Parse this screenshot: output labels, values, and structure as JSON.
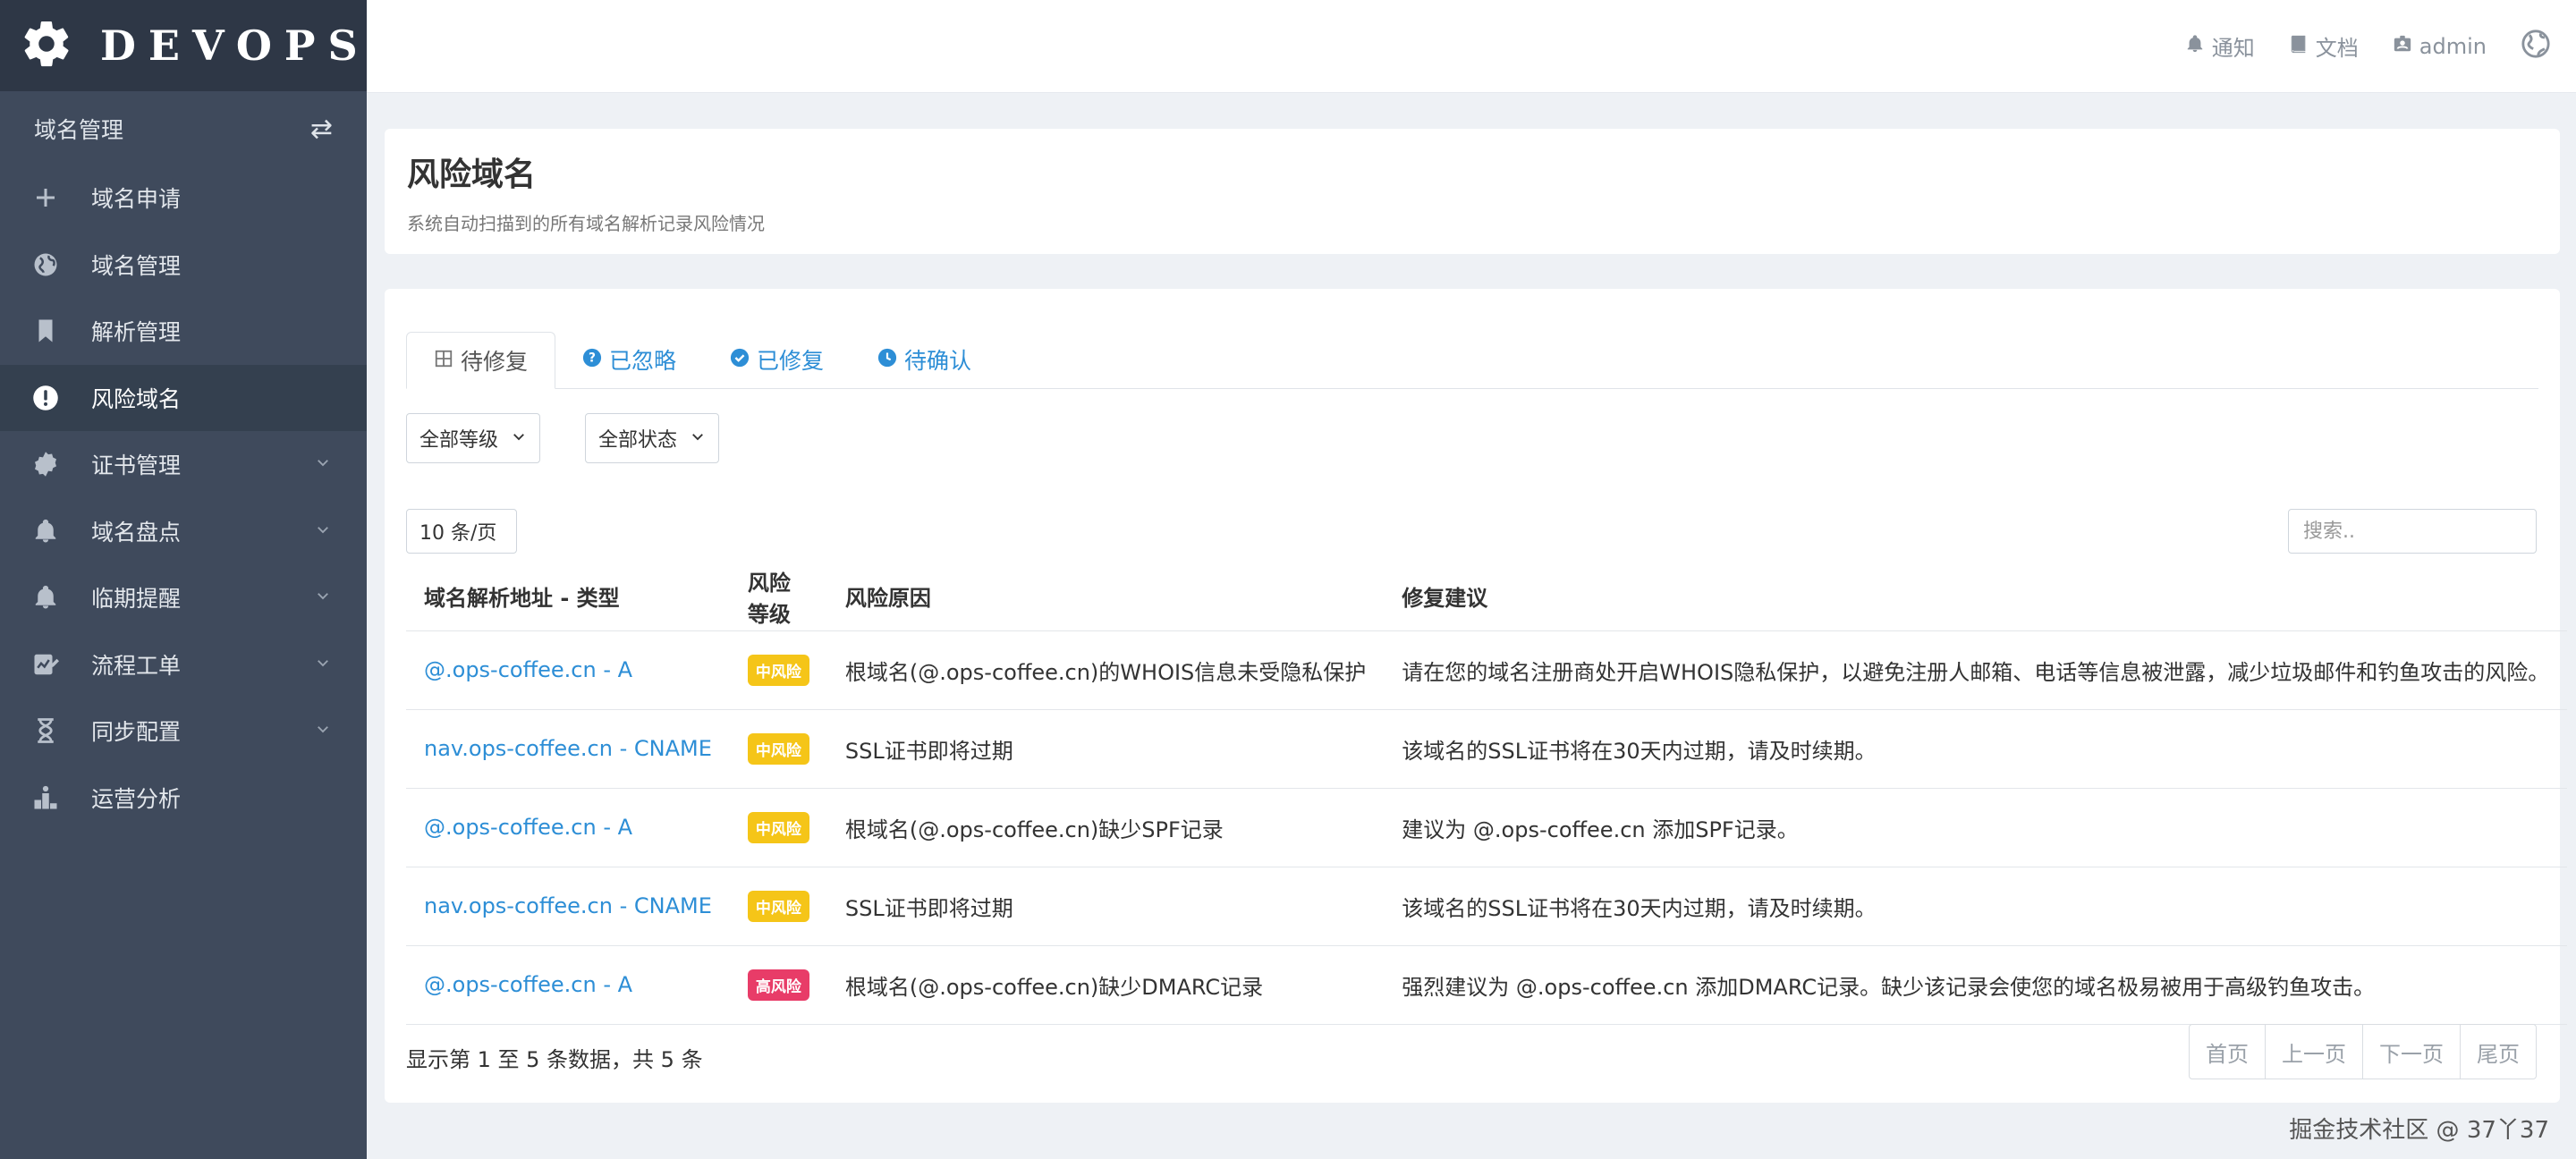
{
  "brand": {
    "name": "DEVOPS"
  },
  "sidebar": {
    "header": "域名管理",
    "items": [
      {
        "label": "域名申请",
        "icon": "plus-icon",
        "active": false,
        "expandable": false
      },
      {
        "label": "域名管理",
        "icon": "globe-icon",
        "active": false,
        "expandable": false
      },
      {
        "label": "解析管理",
        "icon": "bookmark-icon",
        "active": false,
        "expandable": false
      },
      {
        "label": "风险域名",
        "icon": "exclamation-circle-icon",
        "active": true,
        "expandable": false
      },
      {
        "label": "证书管理",
        "icon": "certificate-icon",
        "active": false,
        "expandable": true
      },
      {
        "label": "域名盘点",
        "icon": "bell-icon",
        "active": false,
        "expandable": true
      },
      {
        "label": "临期提醒",
        "icon": "bell-icon",
        "active": false,
        "expandable": true
      },
      {
        "label": "流程工单",
        "icon": "workflow-icon",
        "active": false,
        "expandable": true
      },
      {
        "label": "同步配置",
        "icon": "hourglass-icon",
        "active": false,
        "expandable": true
      },
      {
        "label": "运营分析",
        "icon": "chart-icon",
        "active": false,
        "expandable": false
      }
    ]
  },
  "topbar": {
    "notify": "通知",
    "docs": "文档",
    "user": "admin"
  },
  "page": {
    "title": "风险域名",
    "subtitle": "系统自动扫描到的所有域名解析记录风险情况"
  },
  "tabs": [
    {
      "label": "待修复",
      "icon": "table-icon"
    },
    {
      "label": "已忽略",
      "icon": "question-icon"
    },
    {
      "label": "已修复",
      "icon": "check-circle-icon"
    },
    {
      "label": "待确认",
      "icon": "clock-icon"
    }
  ],
  "filters": {
    "level": "全部等级",
    "status": "全部状态"
  },
  "table_controls": {
    "page_size": "10 条/页",
    "search_placeholder": "搜索.."
  },
  "table": {
    "columns": [
      "域名解析地址 - 类型",
      "风险等级",
      "风险原因",
      "修复建议"
    ],
    "rows": [
      {
        "record": "@.ops-coffee.cn - A",
        "level": "中风险",
        "level_color": "#f5c518",
        "reason": "根域名(@.ops-coffee.cn)的WHOIS信息未受隐私保护",
        "advice": "请在您的域名注册商处开启WHOIS隐私保护，以避免注册人邮箱、电话等信息被泄露，减少垃圾邮件和钓鱼攻击的风险。"
      },
      {
        "record": "nav.ops-coffee.cn - CNAME",
        "level": "中风险",
        "level_color": "#f5c518",
        "reason": "SSL证书即将过期",
        "advice": "该域名的SSL证书将在30天内过期，请及时续期。"
      },
      {
        "record": "@.ops-coffee.cn - A",
        "level": "中风险",
        "level_color": "#f5c518",
        "reason": "根域名(@.ops-coffee.cn)缺少SPF记录",
        "advice": "建议为 @.ops-coffee.cn 添加SPF记录。"
      },
      {
        "record": "nav.ops-coffee.cn - CNAME",
        "level": "中风险",
        "level_color": "#f5c518",
        "reason": "SSL证书即将过期",
        "advice": "该域名的SSL证书将在30天内过期，请及时续期。"
      },
      {
        "record": "@.ops-coffee.cn - A",
        "level": "高风险",
        "level_color": "#e83c68",
        "reason": "根域名(@.ops-coffee.cn)缺少DMARC记录",
        "advice": "强烈建议为 @.ops-coffee.cn 添加DMARC记录。缺少该记录会使您的域名极易被用于高级钓鱼攻击。"
      }
    ]
  },
  "footer": {
    "info": "显示第 1 至 5 条数据，共 5 条",
    "pager": [
      "首页",
      "上一页",
      "下一页",
      "尾页"
    ]
  },
  "watermark": "掘金技术社区 @ 37丫37"
}
